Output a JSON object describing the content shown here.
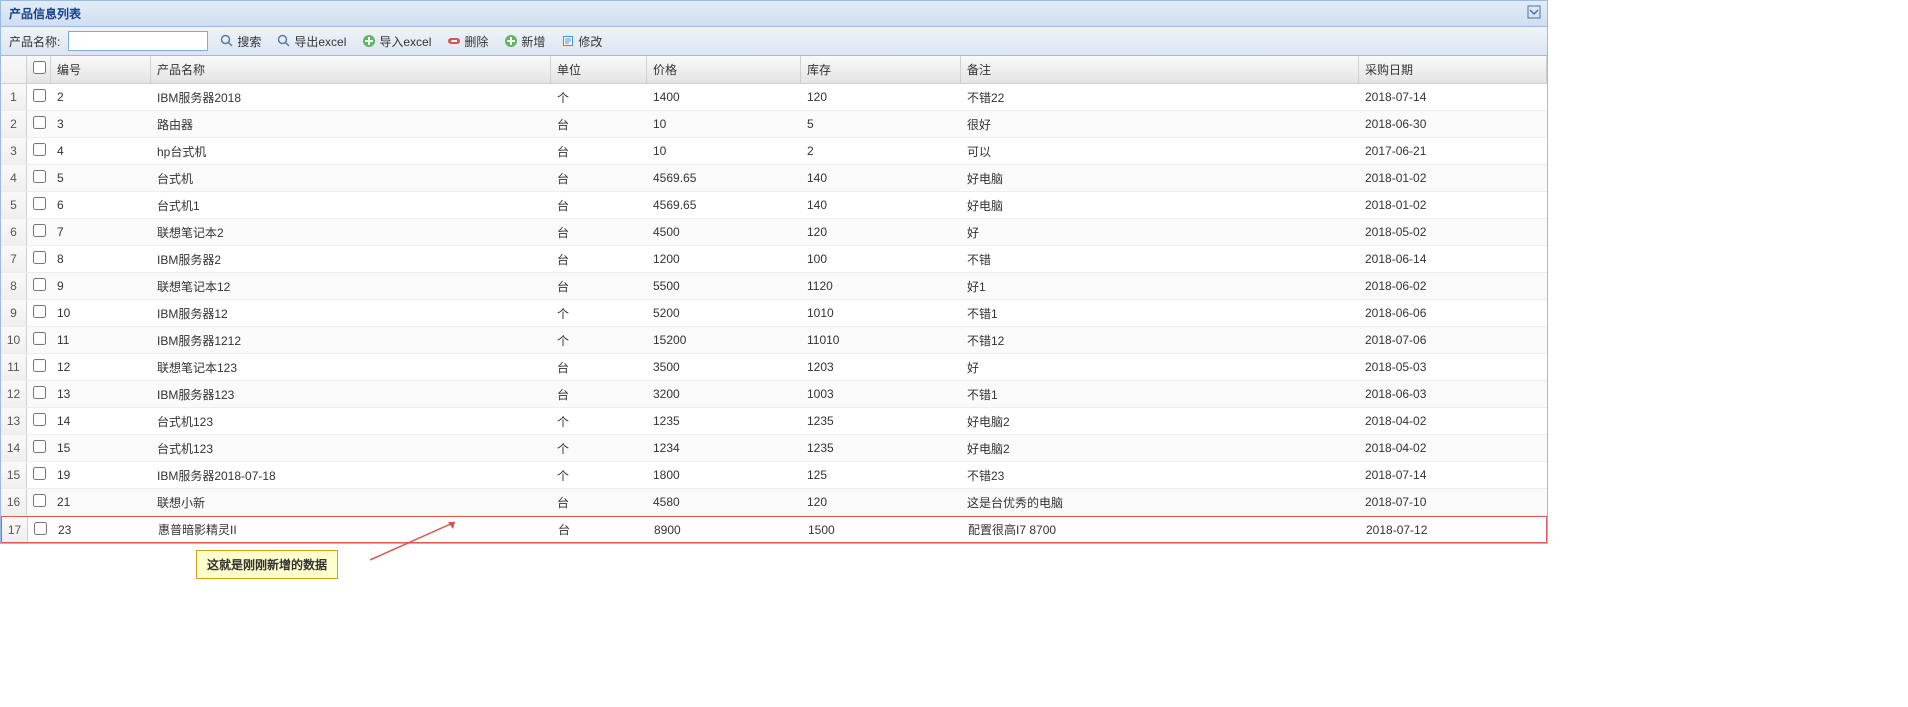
{
  "panel": {
    "title": "产品信息列表"
  },
  "toolbar": {
    "label": "产品名称:",
    "search": "搜索",
    "exportExcel": "导出excel",
    "importExcel": "导入excel",
    "delete": "删除",
    "add": "新增",
    "edit": "修改"
  },
  "columns": {
    "id": "编号",
    "name": "产品名称",
    "unit": "单位",
    "price": "价格",
    "stock": "库存",
    "remark": "备注",
    "date": "采购日期"
  },
  "rows": [
    {
      "n": "1",
      "id": "2",
      "name": "IBM服务器2018",
      "unit": "个",
      "price": "1400",
      "stock": "120",
      "remark": "不错22",
      "date": "2018-07-14"
    },
    {
      "n": "2",
      "id": "3",
      "name": "路由器",
      "unit": "台",
      "price": "10",
      "stock": "5",
      "remark": "很好",
      "date": "2018-06-30"
    },
    {
      "n": "3",
      "id": "4",
      "name": "hp台式机",
      "unit": "台",
      "price": "10",
      "stock": "2",
      "remark": "可以",
      "date": "2017-06-21"
    },
    {
      "n": "4",
      "id": "5",
      "name": "台式机",
      "unit": "台",
      "price": "4569.65",
      "stock": "140",
      "remark": "好电脑",
      "date": "2018-01-02"
    },
    {
      "n": "5",
      "id": "6",
      "name": "台式机1",
      "unit": "台",
      "price": "4569.65",
      "stock": "140",
      "remark": "好电脑",
      "date": "2018-01-02"
    },
    {
      "n": "6",
      "id": "7",
      "name": "联想笔记本2",
      "unit": "台",
      "price": "4500",
      "stock": "120",
      "remark": "好",
      "date": "2018-05-02"
    },
    {
      "n": "7",
      "id": "8",
      "name": "IBM服务器2",
      "unit": "台",
      "price": "1200",
      "stock": "100",
      "remark": "不错",
      "date": "2018-06-14"
    },
    {
      "n": "8",
      "id": "9",
      "name": "联想笔记本12",
      "unit": "台",
      "price": "5500",
      "stock": "1120",
      "remark": "好1",
      "date": "2018-06-02"
    },
    {
      "n": "9",
      "id": "10",
      "name": "IBM服务器12",
      "unit": "个",
      "price": "5200",
      "stock": "1010",
      "remark": "不错1",
      "date": "2018-06-06"
    },
    {
      "n": "10",
      "id": "11",
      "name": "IBM服务器1212",
      "unit": "个",
      "price": "15200",
      "stock": "11010",
      "remark": "不错12",
      "date": "2018-07-06"
    },
    {
      "n": "11",
      "id": "12",
      "name": "联想笔记本123",
      "unit": "台",
      "price": "3500",
      "stock": "1203",
      "remark": "好",
      "date": "2018-05-03"
    },
    {
      "n": "12",
      "id": "13",
      "name": "IBM服务器123",
      "unit": "台",
      "price": "3200",
      "stock": "1003",
      "remark": "不错1",
      "date": "2018-06-03"
    },
    {
      "n": "13",
      "id": "14",
      "name": "台式机123",
      "unit": "个",
      "price": "1235",
      "stock": "1235",
      "remark": "好电脑2",
      "date": "2018-04-02"
    },
    {
      "n": "14",
      "id": "15",
      "name": "台式机123",
      "unit": "个",
      "price": "1234",
      "stock": "1235",
      "remark": "好电脑2",
      "date": "2018-04-02"
    },
    {
      "n": "15",
      "id": "19",
      "name": "IBM服务器2018-07-18",
      "unit": "个",
      "price": "1800",
      "stock": "125",
      "remark": "不错23",
      "date": "2018-07-14"
    },
    {
      "n": "16",
      "id": "21",
      "name": "联想小新",
      "unit": "台",
      "price": "4580",
      "stock": "120",
      "remark": "这是台优秀的电脑",
      "date": "2018-07-10"
    },
    {
      "n": "17",
      "id": "23",
      "name": "惠普暗影精灵II",
      "unit": "台",
      "price": "8900",
      "stock": "1500",
      "remark": "配置很高I7 8700",
      "date": "2018-07-12"
    }
  ],
  "highlightRow": 16,
  "annotation": "这就是刚刚新增的数据"
}
